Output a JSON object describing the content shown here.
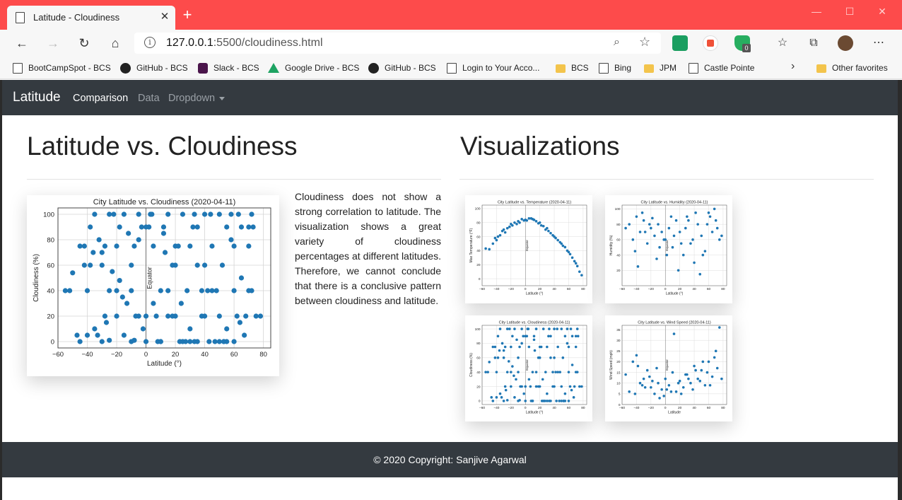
{
  "browser": {
    "tab_title": "Latitude - Cloudiness",
    "tab_close": "✕",
    "new_tab": "+",
    "url_host": "127.0.0.1",
    "url_rest": ":5500/cloudiness.html",
    "window_controls": [
      "—",
      "☐",
      "✕"
    ],
    "extension_badge": "0",
    "bookmarks": [
      {
        "label": "BootCampSpot - BCS",
        "icon": "page-icon"
      },
      {
        "label": "GitHub - BCS",
        "icon": "github-icon"
      },
      {
        "label": "Slack - BCS",
        "icon": "slack-icon"
      },
      {
        "label": "Google Drive - BCS",
        "icon": "google-drive-icon"
      },
      {
        "label": "GitHub - BCS",
        "icon": "github-icon"
      },
      {
        "label": "Login to Your Acco...",
        "icon": "page-icon"
      },
      {
        "label": "BCS",
        "icon": "folder-icon"
      },
      {
        "label": "Bing",
        "icon": "page-icon"
      },
      {
        "label": "JPM",
        "icon": "folder-icon"
      },
      {
        "label": "Castle Pointe",
        "icon": "page-icon"
      }
    ],
    "other_favorites": "Other favorites"
  },
  "navbar": {
    "brand": "Latitude",
    "links": [
      "Comparison",
      "Data",
      "Dropdown"
    ]
  },
  "main": {
    "heading": "Latitude vs. Cloudiness",
    "description": "Cloudiness does not show a strong correlation to latitude. The visualization shows a great variety of cloudiness percentages at different latitudes. Therefore, we cannot conclude that there is a conclusive pattern between cloudiness and latitude."
  },
  "visualizations": {
    "heading": "Visualizations"
  },
  "footer": {
    "text": "© 2020 Copyright: Sanjive Agarwal"
  },
  "colors": {
    "point": "#1f77b4",
    "navbar_bg": "#343a40",
    "titlebar": "#fd4b4b"
  },
  "chart_data": [
    {
      "type": "scatter",
      "title": "City Latitude vs. Cloudiness (2020-04-11)",
      "xlabel": "Latitude (°)",
      "ylabel": "Cloudiness (%)",
      "xlim": [
        -60,
        85
      ],
      "ylim": [
        -5,
        105
      ],
      "xticks": [
        -60,
        -40,
        -20,
        0,
        20,
        40,
        60,
        80
      ],
      "yticks": [
        0,
        20,
        40,
        60,
        80,
        100
      ],
      "annotations": [
        "Equator"
      ],
      "grid": true,
      "x": [
        -55,
        -50,
        -45,
        -42,
        -40,
        -38,
        -35,
        -32,
        -30,
        -28,
        -25,
        -23,
        -20,
        -18,
        -15,
        -12,
        -10,
        -8,
        -5,
        -3,
        0,
        3,
        5,
        8,
        10,
        12,
        15,
        18,
        20,
        23,
        25,
        28,
        30,
        33,
        35,
        38,
        40,
        43,
        45,
        48,
        50,
        53,
        55,
        58,
        60,
        63,
        65,
        68,
        70,
        72,
        -40,
        -35,
        -30,
        -25,
        -20,
        -15,
        -10,
        -5,
        0,
        5,
        10,
        15,
        20,
        25,
        30,
        35,
        40,
        45,
        50,
        55,
        60,
        65,
        70,
        -30,
        -20,
        -10,
        0,
        10,
        20,
        30,
        40,
        50,
        60,
        70,
        -45,
        -25,
        -5,
        15,
        35,
        55,
        75,
        -38,
        -18,
        2,
        22,
        42,
        62,
        -52,
        -33,
        -13,
        7,
        27,
        47,
        67,
        -28,
        -8,
        12,
        32,
        52,
        72,
        -36,
        -16,
        4,
        24,
        44,
        64,
        78,
        -42,
        -22,
        -2,
        18,
        38,
        58,
        -47,
        -27,
        -7,
        13,
        33,
        53,
        73
      ],
      "y": [
        40,
        54,
        0,
        75,
        40,
        90,
        100,
        80,
        70,
        20,
        100,
        55,
        75,
        90,
        100,
        85,
        40,
        75,
        100,
        90,
        20,
        100,
        75,
        0,
        40,
        90,
        100,
        20,
        75,
        0,
        100,
        40,
        75,
        0,
        90,
        20,
        100,
        0,
        75,
        40,
        100,
        0,
        90,
        100,
        75,
        100,
        90,
        20,
        75,
        100,
        5,
        10,
        0,
        40,
        20,
        5,
        60,
        20,
        0,
        30,
        0,
        40,
        20,
        0,
        10,
        0,
        20,
        40,
        0,
        0,
        40,
        50,
        40,
        60,
        40,
        0,
        90,
        0,
        60,
        0,
        60,
        20,
        0,
        90,
        75,
        1,
        80,
        20,
        60,
        10,
        20,
        60,
        48,
        90,
        75,
        40,
        20,
        40,
        5,
        30,
        20,
        0,
        0,
        5,
        75,
        1,
        85,
        90,
        60,
        40,
        70,
        35,
        100,
        30,
        100,
        15,
        20,
        60,
        100,
        10,
        60,
        40,
        80,
        5,
        15,
        20,
        70,
        100,
        0,
        90,
        100
      ]
    },
    {
      "type": "scatter",
      "title": "City Latitude vs. Temperature (2020-04-11)",
      "xlabel": "Latitude (°)",
      "ylabel": "Max Temperature (°F)",
      "xlim": [
        -60,
        85
      ],
      "ylim": [
        -10,
        105
      ],
      "xticks": [
        -60,
        -40,
        -20,
        0,
        20,
        40,
        60,
        80
      ],
      "yticks": [
        0,
        20,
        40,
        60,
        80,
        100
      ],
      "annotations": [
        "Equator"
      ],
      "x": [
        -55,
        -50,
        -45,
        -40,
        -35,
        -30,
        -25,
        -20,
        -15,
        -10,
        -5,
        0,
        5,
        10,
        15,
        20,
        25,
        30,
        35,
        40,
        45,
        50,
        55,
        60,
        65,
        70,
        75,
        -42,
        -32,
        -22,
        -12,
        -2,
        8,
        18,
        28,
        38,
        48,
        58,
        68,
        78,
        -38,
        -28,
        -18,
        -8,
        2,
        12,
        22,
        32,
        42,
        52,
        62,
        72
      ],
      "y": [
        43,
        42,
        50,
        55,
        62,
        70,
        72,
        78,
        80,
        82,
        85,
        84,
        86,
        85,
        82,
        80,
        75,
        72,
        65,
        60,
        55,
        50,
        45,
        38,
        30,
        22,
        10,
        58,
        68,
        74,
        78,
        83,
        86,
        79,
        70,
        62,
        52,
        40,
        25,
        5,
        60,
        66,
        76,
        80,
        83,
        84,
        76,
        68,
        58,
        47,
        35,
        18
      ]
    },
    {
      "type": "scatter",
      "title": "City Latitude vs. Humidity (2020-04-11)",
      "xlabel": "Latitude (°)",
      "ylabel": "Humidity (%)",
      "xlim": [
        -60,
        85
      ],
      "ylim": [
        0,
        105
      ],
      "xticks": [
        -60,
        -40,
        -20,
        0,
        20,
        40,
        60,
        80
      ],
      "yticks": [
        20,
        40,
        60,
        80,
        100
      ],
      "annotations": [
        "Equator"
      ],
      "x": [
        -55,
        -50,
        -45,
        -40,
        -35,
        -30,
        -25,
        -20,
        -15,
        -10,
        -5,
        0,
        5,
        10,
        15,
        20,
        25,
        30,
        35,
        40,
        45,
        50,
        55,
        60,
        65,
        70,
        75,
        -42,
        -32,
        -22,
        -12,
        -2,
        8,
        18,
        28,
        38,
        48,
        58,
        68,
        78,
        -38,
        -28,
        -18,
        -8,
        2,
        12,
        22,
        32,
        42,
        52,
        62,
        72
      ],
      "y": [
        75,
        80,
        60,
        90,
        70,
        85,
        55,
        75,
        65,
        80,
        70,
        60,
        75,
        50,
        85,
        70,
        40,
        90,
        55,
        30,
        80,
        65,
        45,
        95,
        70,
        85,
        60,
        45,
        95,
        80,
        35,
        60,
        90,
        20,
        75,
        60,
        15,
        80,
        100,
        65,
        25,
        70,
        88,
        50,
        40,
        65,
        55,
        85,
        95,
        40,
        90,
        75
      ]
    },
    {
      "type": "scatter",
      "title": "City Latitude vs. Wind Speed (2020-04-11)",
      "xlabel": "Latitude",
      "ylabel": "Wind Speed (mph)",
      "xlim": [
        -60,
        85
      ],
      "ylim": [
        0,
        37
      ],
      "xticks": [
        -60,
        -40,
        -20,
        0,
        20,
        40,
        60,
        80
      ],
      "yticks": [
        0,
        5,
        10,
        15,
        20,
        25,
        30,
        35
      ],
      "annotations": [
        "Equator"
      ],
      "x": [
        -55,
        -50,
        -45,
        -40,
        -35,
        -30,
        -25,
        -20,
        -15,
        -10,
        -5,
        0,
        5,
        10,
        15,
        20,
        25,
        30,
        35,
        40,
        45,
        50,
        55,
        60,
        65,
        70,
        75,
        -42,
        -32,
        -22,
        -12,
        -2,
        8,
        18,
        28,
        38,
        48,
        58,
        68,
        78,
        -38,
        -28,
        -18,
        -8,
        2,
        12,
        22,
        32,
        42,
        52,
        62,
        72
      ],
      "y": [
        14,
        6,
        20,
        23,
        10,
        12,
        16,
        8,
        5,
        10,
        7,
        12,
        9,
        15,
        6,
        11,
        8,
        14,
        10,
        18,
        12,
        16,
        9,
        20,
        13,
        25,
        36,
        5,
        9,
        13,
        17,
        4,
        6,
        10,
        14,
        7,
        11,
        15,
        22,
        12,
        18,
        8,
        11,
        3,
        7,
        33,
        5,
        12,
        16,
        20,
        9,
        17
      ]
    }
  ]
}
